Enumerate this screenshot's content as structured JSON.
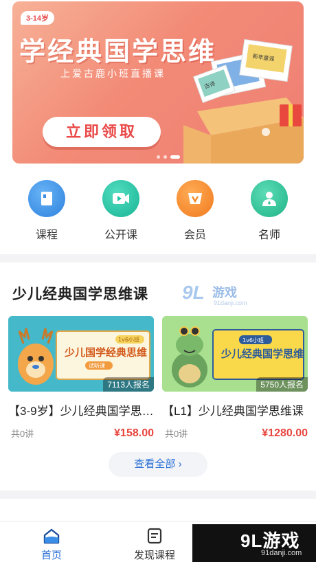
{
  "banner": {
    "age_tag": "3-14岁",
    "title": "学经典国学思维",
    "subtitle": "上爱古鹿小班直播课",
    "cta": "立即领取",
    "box_titles": [
      "古诗",
      "新年童谣"
    ],
    "colors": {
      "primary": "#ef7f74",
      "cta_text": "#e94a48"
    }
  },
  "nav": [
    {
      "label": "课程",
      "icon": "book-icon",
      "color": "#3b8de6"
    },
    {
      "label": "公开课",
      "icon": "video-icon",
      "color": "#22c3a6"
    },
    {
      "label": "会员",
      "icon": "vip-icon",
      "color": "#f28c2b"
    },
    {
      "label": "名师",
      "icon": "teacher-icon",
      "color": "#2ec49c"
    }
  ],
  "section": {
    "title": "少儿经典国学思维课",
    "view_all": "查看全部 ›",
    "courses": [
      {
        "title": "【3-9岁】少儿经典国学思维课",
        "thumb_tag": "1v6小班",
        "thumb_title": "少儿国学经典思维",
        "thumb_badge": "试听课",
        "enrolled": "7113人报名",
        "lessons": "共0讲",
        "price": "¥158.00"
      },
      {
        "title": "【L1】少儿经典国学思维课",
        "thumb_tag": "1v6小班",
        "thumb_title": "少儿经典国学思维",
        "enrolled": "5750人报名",
        "lessons": "共0讲",
        "price": "¥1280.00"
      }
    ]
  },
  "tabs": [
    {
      "label": "首页",
      "icon": "home-icon",
      "active": true
    },
    {
      "label": "发现课程",
      "icon": "discover-icon",
      "active": false
    }
  ],
  "watermark": {
    "big": "9L游戏",
    "small": "91danji.com",
    "float_a": "9L",
    "float_b": "游戏",
    "float_c": "91danji.com"
  },
  "colors": {
    "accent": "#2a6fd6",
    "price": "#e8463f"
  }
}
